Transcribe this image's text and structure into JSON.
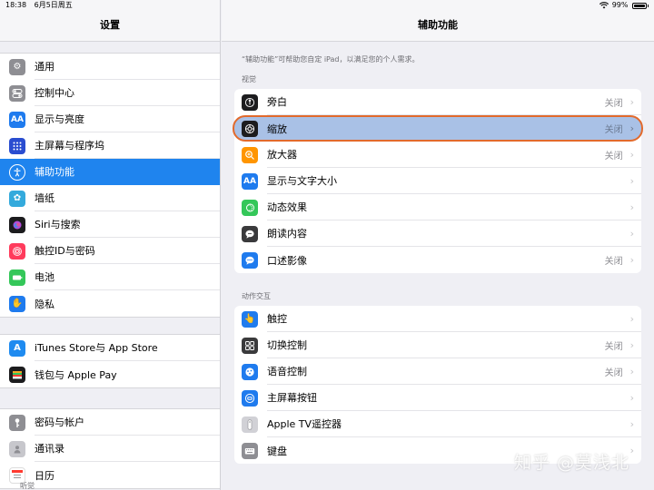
{
  "status": {
    "time": "18:38",
    "date": "6月5日周五",
    "battery": "99%"
  },
  "sidebar": {
    "title": "设置",
    "groups": [
      [
        {
          "label": "通用",
          "icon": "gear-icon",
          "color": "#8e8e93"
        },
        {
          "label": "控制中心",
          "icon": "toggle-icon",
          "color": "#8e8e93"
        },
        {
          "label": "显示与亮度",
          "icon": "aa-icon",
          "color": "#1f7bee"
        },
        {
          "label": "主屏幕与程序坞",
          "icon": "grid-icon",
          "color": "#2a4dd0"
        },
        {
          "label": "辅助功能",
          "icon": "accessibility-icon",
          "color": "#1f84ee"
        },
        {
          "label": "墙纸",
          "icon": "flower-icon",
          "color": "#34aadc"
        },
        {
          "label": "Siri与搜索",
          "icon": "siri-icon",
          "color": "#3a3a3c"
        },
        {
          "label": "触控ID与密码",
          "icon": "fingerprint-icon",
          "color": "#ff3b5c"
        },
        {
          "label": "电池",
          "icon": "battery-icon",
          "color": "#34c759"
        },
        {
          "label": "隐私",
          "icon": "hand-icon",
          "color": "#1f7bee"
        }
      ],
      [
        {
          "label": "iTunes Store与 App Store",
          "icon": "appstore-icon",
          "color": "#1f8bf0"
        },
        {
          "label": "钱包与 Apple Pay",
          "icon": "wallet-icon",
          "color": "#1c1c1e"
        }
      ],
      [
        {
          "label": "密码与帐户",
          "icon": "key-icon",
          "color": "#8e8e93"
        },
        {
          "label": "通讯录",
          "icon": "contacts-icon",
          "color": "#b0b0b5"
        },
        {
          "label": "日历",
          "icon": "calendar-icon",
          "color": "#ffffff"
        }
      ]
    ]
  },
  "main": {
    "title": "辅助功能",
    "description": "“辅助功能”可帮助您自定 iPad，以满足您的个人需求。",
    "sections": [
      {
        "header": "视觉",
        "rows": [
          {
            "label": "旁白",
            "value": "关闭",
            "icon": "voiceover-icon",
            "color": "#1c1c1e"
          },
          {
            "label": "缩放",
            "value": "关闭",
            "icon": "zoom-icon",
            "color": "#1c1c1e"
          },
          {
            "label": "放大器",
            "value": "关闭",
            "icon": "magnifier-icon",
            "color": "#ff9500"
          },
          {
            "label": "显示与文字大小",
            "value": "",
            "icon": "aa-icon",
            "color": "#1f7bee"
          },
          {
            "label": "动态效果",
            "value": "",
            "icon": "motion-icon",
            "color": "#34c759"
          },
          {
            "label": "朗读内容",
            "value": "",
            "icon": "speech-icon",
            "color": "#3a3a3c"
          },
          {
            "label": "口述影像",
            "value": "关闭",
            "icon": "chat-icon",
            "color": "#1f7bee"
          }
        ]
      },
      {
        "header": "动作交互",
        "rows": [
          {
            "label": "触控",
            "value": "",
            "icon": "touch-icon",
            "color": "#1f7bee"
          },
          {
            "label": "切换控制",
            "value": "关闭",
            "icon": "switch-control-icon",
            "color": "#3a3a3c"
          },
          {
            "label": "语音控制",
            "value": "关闭",
            "icon": "voice-control-icon",
            "color": "#1f7bee"
          },
          {
            "label": "主屏幕按钮",
            "value": "",
            "icon": "home-button-icon",
            "color": "#1f7bee"
          },
          {
            "label": "Apple TV遥控器",
            "value": "",
            "icon": "remote-icon",
            "color": "#c7c7cc"
          },
          {
            "label": "键盘",
            "value": "",
            "icon": "keyboard-icon",
            "color": "#8e8e93"
          }
        ]
      }
    ],
    "next_header": "听觉"
  },
  "watermark": "知乎 @莫浅北"
}
